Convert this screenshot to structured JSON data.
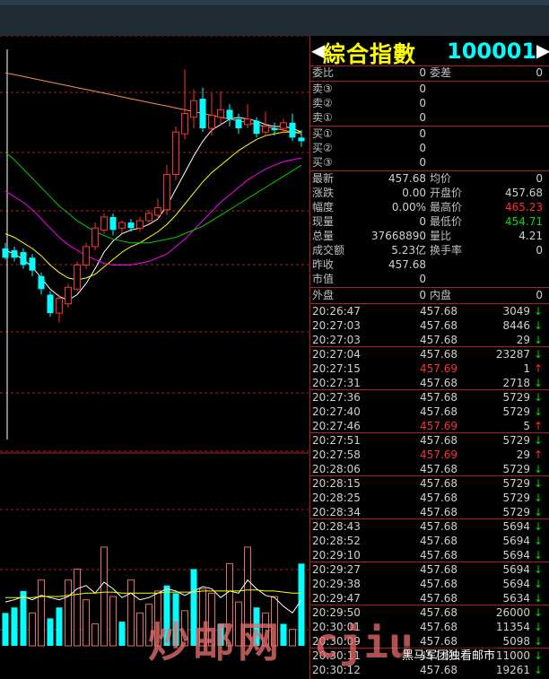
{
  "header": {
    "title": "綜合指數",
    "code": "100001",
    "left_arrow": "◀",
    "right_arrow": "▶"
  },
  "orderbook": {
    "weibi_label": "委比",
    "weibi_val": "0",
    "weicha_label": "委差",
    "weicha_val": "0",
    "asks": [
      {
        "label": "卖③",
        "price": "0"
      },
      {
        "label": "卖②",
        "price": "0"
      },
      {
        "label": "卖①",
        "price": "0"
      }
    ],
    "bids": [
      {
        "label": "买①",
        "price": "0"
      },
      {
        "label": "买②",
        "price": "0"
      },
      {
        "label": "买③",
        "price": "0"
      }
    ]
  },
  "stats": {
    "latest_label": "最新",
    "latest_val": "457.68",
    "avg_label": "均价",
    "avg_val": "0",
    "change_label": "涨跌",
    "change_val": "0.00",
    "open_label": "开盘价",
    "open_val": "457.68",
    "pct_label": "幅度",
    "pct_val": "0.00%",
    "high_label": "最高价",
    "high_val": "465.23",
    "vol_label": "现量",
    "vol_val": "0",
    "low_label": "最低价",
    "low_val": "454.71",
    "total_label": "总量",
    "total_val": "37668890",
    "ratio_label": "量比",
    "ratio_val": "4.21",
    "amount_label": "成交额",
    "amount_val": "5.23亿",
    "turnover_label": "换手率",
    "turnover_val": "0",
    "prev_label": "昨收",
    "prev_val": "457.68",
    "mcap_label": "市值",
    "mcap_val": "0",
    "outer_label": "外盘",
    "outer_val": "0",
    "inner_label": "内盘",
    "inner_val": "0"
  },
  "ticks": [
    {
      "time": "20:26:47",
      "price": "457.68",
      "vol": "3049",
      "up": false
    },
    {
      "time": "20:27:03",
      "price": "457.68",
      "vol": "8446",
      "up": false
    },
    {
      "time": "20:27:03",
      "price": "457.68",
      "vol": "29",
      "up": false
    },
    {
      "time": "20:27:04",
      "price": "457.68",
      "vol": "23287",
      "up": false
    },
    {
      "time": "20:27:15",
      "price": "457.69",
      "vol": "1",
      "up": true
    },
    {
      "time": "20:27:31",
      "price": "457.68",
      "vol": "2718",
      "up": false
    },
    {
      "time": "20:27:36",
      "price": "457.68",
      "vol": "5729",
      "up": false
    },
    {
      "time": "20:27:40",
      "price": "457.68",
      "vol": "5729",
      "up": false
    },
    {
      "time": "20:27:46",
      "price": "457.69",
      "vol": "5",
      "up": true
    },
    {
      "time": "20:27:51",
      "price": "457.68",
      "vol": "5729",
      "up": false
    },
    {
      "time": "20:27:58",
      "price": "457.69",
      "vol": "29",
      "up": true
    },
    {
      "time": "20:28:06",
      "price": "457.68",
      "vol": "5729",
      "up": false
    },
    {
      "time": "20:28:15",
      "price": "457.68",
      "vol": "5729",
      "up": false
    },
    {
      "time": "20:28:25",
      "price": "457.68",
      "vol": "5729",
      "up": false
    },
    {
      "time": "20:28:34",
      "price": "457.68",
      "vol": "5729",
      "up": false
    },
    {
      "time": "20:28:43",
      "price": "457.68",
      "vol": "5694",
      "up": false
    },
    {
      "time": "20:28:52",
      "price": "457.68",
      "vol": "5694",
      "up": false
    },
    {
      "time": "20:29:10",
      "price": "457.68",
      "vol": "5694",
      "up": false
    },
    {
      "time": "20:29:27",
      "price": "457.68",
      "vol": "5694",
      "up": false
    },
    {
      "time": "20:29:38",
      "price": "457.68",
      "vol": "5694",
      "up": false
    },
    {
      "time": "20:29:47",
      "price": "457.68",
      "vol": "5634",
      "up": false
    },
    {
      "time": "20:29:50",
      "price": "457.68",
      "vol": "26000",
      "up": false
    },
    {
      "time": "20:30:01",
      "price": "457.68",
      "vol": "11354",
      "up": false
    },
    {
      "time": "20:30:09",
      "price": "457.68",
      "vol": "5098",
      "up": false
    },
    {
      "time": "20:30:11",
      "price": "457.68",
      "vol": "11000",
      "up": false
    },
    {
      "time": "20:30:12",
      "price": "457.68",
      "vol": "19261",
      "up": false
    }
  ],
  "watermark": {
    "text1": "炒邮网",
    "text2": "cjiu",
    "wechat": "黑马军团独看邮市"
  },
  "colors": {
    "up": "#ff3030",
    "down": "#00ffff",
    "grid": "#b02020",
    "ma1": "#ffffff",
    "ma2": "#ffff00",
    "ma3": "#ff00ff",
    "ma4": "#00cc00",
    "ma5": "#ff8c50"
  },
  "chart_data": {
    "type": "candlestick",
    "title": "",
    "xlabel": "",
    "ylabel": "",
    "candles": [
      {
        "o": 455.5,
        "c": 455.0,
        "h": 455.8,
        "l": 454.9
      },
      {
        "o": 455.4,
        "c": 455.0,
        "h": 455.6,
        "l": 454.8
      },
      {
        "o": 455.3,
        "c": 454.6,
        "h": 455.5,
        "l": 454.4
      },
      {
        "o": 455.0,
        "c": 454.3,
        "h": 455.2,
        "l": 454.0
      },
      {
        "o": 454.0,
        "c": 453.3,
        "h": 454.2,
        "l": 453.0
      },
      {
        "o": 453.0,
        "c": 452.0,
        "h": 453.2,
        "l": 451.8
      },
      {
        "o": 452.0,
        "c": 452.8,
        "h": 453.0,
        "l": 451.5
      },
      {
        "o": 452.5,
        "c": 453.4,
        "h": 453.6,
        "l": 452.3
      },
      {
        "o": 453.3,
        "c": 454.6,
        "h": 454.8,
        "l": 453.2
      },
      {
        "o": 454.6,
        "c": 455.6,
        "h": 455.8,
        "l": 454.4
      },
      {
        "o": 455.6,
        "c": 456.6,
        "h": 456.9,
        "l": 455.4
      },
      {
        "o": 456.5,
        "c": 457.2,
        "h": 457.4,
        "l": 456.3
      },
      {
        "o": 457.2,
        "c": 456.5,
        "h": 457.4,
        "l": 456.2
      },
      {
        "o": 456.6,
        "c": 456.9,
        "h": 457.0,
        "l": 456.3
      },
      {
        "o": 456.9,
        "c": 456.6,
        "h": 457.1,
        "l": 456.4
      },
      {
        "o": 456.6,
        "c": 457.0,
        "h": 457.2,
        "l": 456.4
      },
      {
        "o": 457.0,
        "c": 457.4,
        "h": 457.6,
        "l": 456.8
      },
      {
        "o": 457.3,
        "c": 457.7,
        "h": 458.2,
        "l": 457.1
      },
      {
        "o": 457.6,
        "c": 459.5,
        "h": 460.0,
        "l": 457.3
      },
      {
        "o": 459.5,
        "c": 461.8,
        "h": 462.1,
        "l": 459.2
      },
      {
        "o": 461.7,
        "c": 462.8,
        "h": 465.2,
        "l": 461.4
      },
      {
        "o": 462.6,
        "c": 463.5,
        "h": 464.1,
        "l": 462.0
      },
      {
        "o": 463.6,
        "c": 462.0,
        "h": 464.2,
        "l": 461.8
      },
      {
        "o": 462.0,
        "c": 462.7,
        "h": 463.9,
        "l": 461.6
      },
      {
        "o": 462.6,
        "c": 463.0,
        "h": 464.0,
        "l": 462.2
      },
      {
        "o": 463.0,
        "c": 462.5,
        "h": 463.3,
        "l": 462.1
      },
      {
        "o": 462.5,
        "c": 462.0,
        "h": 462.8,
        "l": 461.7
      },
      {
        "o": 462.2,
        "c": 462.5,
        "h": 463.3,
        "l": 462.0
      },
      {
        "o": 462.4,
        "c": 461.7,
        "h": 462.6,
        "l": 461.5
      },
      {
        "o": 461.8,
        "c": 462.1,
        "h": 462.9,
        "l": 461.6
      },
      {
        "o": 462.0,
        "c": 461.9,
        "h": 462.3,
        "l": 461.6
      },
      {
        "o": 462.0,
        "c": 462.3,
        "h": 462.5,
        "l": 461.7
      },
      {
        "o": 462.3,
        "c": 461.5,
        "h": 462.8,
        "l": 461.3
      },
      {
        "o": 461.5,
        "c": 461.3,
        "h": 461.9,
        "l": 461.0
      }
    ],
    "volumes": [
      {
        "v": 30,
        "up": false
      },
      {
        "v": 35,
        "up": false
      },
      {
        "v": 50,
        "up": false
      },
      {
        "v": 30,
        "up": true
      },
      {
        "v": 60,
        "up": true
      },
      {
        "v": 25,
        "up": false
      },
      {
        "v": 35,
        "up": false
      },
      {
        "v": 60,
        "up": true
      },
      {
        "v": 70,
        "up": true
      },
      {
        "v": 42,
        "up": true
      },
      {
        "v": 20,
        "up": true
      },
      {
        "v": 90,
        "up": true
      },
      {
        "v": 45,
        "up": true
      },
      {
        "v": 22,
        "up": false
      },
      {
        "v": 60,
        "up": true
      },
      {
        "v": 30,
        "up": true
      },
      {
        "v": 38,
        "up": true
      },
      {
        "v": 50,
        "up": true
      },
      {
        "v": 55,
        "up": false
      },
      {
        "v": 48,
        "up": false
      },
      {
        "v": 32,
        "up": true
      },
      {
        "v": 70,
        "up": false
      },
      {
        "v": 52,
        "up": true
      },
      {
        "v": 48,
        "up": true
      },
      {
        "v": 20,
        "up": false
      },
      {
        "v": 75,
        "up": true
      },
      {
        "v": 40,
        "up": true
      },
      {
        "v": 90,
        "up": true
      },
      {
        "v": 35,
        "up": false
      },
      {
        "v": 30,
        "up": true
      },
      {
        "v": 45,
        "up": true
      },
      {
        "v": 20,
        "up": false
      },
      {
        "v": 15,
        "up": true
      },
      {
        "v": 75,
        "up": false
      }
    ],
    "ma_series": [
      {
        "name": "",
        "color": "#ffffff",
        "values": [
          455.4,
          455.2,
          454.9,
          454.5,
          453.9,
          453.3,
          452.9,
          452.7,
          453.0,
          453.6,
          454.4,
          455.3,
          455.9,
          456.3,
          456.5,
          456.6,
          456.8,
          457.1,
          457.8,
          458.7,
          459.6,
          460.5,
          461.3,
          461.9,
          462.2,
          462.5,
          462.6,
          462.5,
          462.4,
          462.2,
          462.1,
          462.1,
          462.0,
          461.8
        ]
      },
      {
        "name": "",
        "color": "#ffff00",
        "values": [
          456.3,
          456.1,
          455.8,
          455.5,
          455.1,
          454.6,
          454.2,
          453.9,
          453.8,
          453.9,
          454.1,
          454.5,
          454.9,
          455.3,
          455.6,
          455.8,
          456.1,
          456.4,
          456.8,
          457.3,
          457.9,
          458.5,
          459.1,
          459.6,
          460.0,
          460.4,
          460.8,
          461.1,
          461.4,
          461.6,
          461.7,
          461.8,
          461.8,
          461.8
        ]
      },
      {
        "name": "",
        "color": "#ff00ff",
        "values": [
          458.6,
          458.3,
          458.0,
          457.6,
          457.1,
          456.6,
          456.1,
          455.7,
          455.4,
          455.1,
          454.9,
          454.7,
          454.6,
          454.6,
          454.6,
          454.7,
          454.8,
          455.0,
          455.2,
          455.6,
          456.0,
          456.5,
          457.0,
          457.5,
          458.0,
          458.4,
          458.8,
          459.2,
          459.5,
          459.8,
          460.0,
          460.2,
          460.3,
          460.4
        ]
      },
      {
        "name": "",
        "color": "#00cc00",
        "values": [
          460.7,
          460.3,
          459.8,
          459.3,
          458.8,
          458.3,
          457.8,
          457.4,
          457.0,
          456.7,
          456.4,
          456.2,
          456.0,
          455.9,
          455.8,
          455.8,
          455.8,
          455.9,
          456.0,
          456.1,
          456.3,
          456.5,
          456.7,
          457.0,
          457.3,
          457.6,
          457.9,
          458.2,
          458.5,
          458.8,
          459.1,
          459.4,
          459.7,
          460.0
        ]
      },
      {
        "name": "",
        "color": "#ff8c50",
        "values": [
          465.0,
          464.9,
          464.8,
          464.7,
          464.6,
          464.5,
          464.4,
          464.3,
          464.2,
          464.1,
          464.0,
          463.9,
          463.8,
          463.7,
          463.6,
          463.5,
          463.4,
          463.3,
          463.2,
          463.1,
          463.0,
          462.9,
          462.8,
          462.7,
          462.6,
          462.5,
          462.4,
          462.3,
          462.2,
          462.1,
          462.0,
          461.9,
          461.8,
          461.7
        ]
      }
    ],
    "vol_ma_series": [
      {
        "name": "",
        "color": "#ffffff",
        "values": [
          40,
          42,
          45,
          42,
          46,
          44,
          42,
          45,
          52,
          55,
          48,
          58,
          52,
          44,
          48,
          42,
          44,
          48,
          52,
          50,
          46,
          50,
          54,
          52,
          44,
          50,
          48,
          60,
          52,
          46,
          44,
          36,
          30,
          42
        ]
      },
      {
        "name": "",
        "color": "#ffff00",
        "values": [
          44,
          44,
          44,
          44,
          45,
          45,
          45,
          46,
          47,
          48,
          48,
          49,
          49,
          48,
          48,
          48,
          48,
          48,
          49,
          49,
          49,
          49,
          50,
          50,
          50,
          50,
          50,
          51,
          51,
          50,
          50,
          49,
          48,
          48
        ]
      }
    ],
    "price_ylim": [
      450.5,
      467.0
    ],
    "vol_ylim": [
      0,
      180
    ]
  }
}
